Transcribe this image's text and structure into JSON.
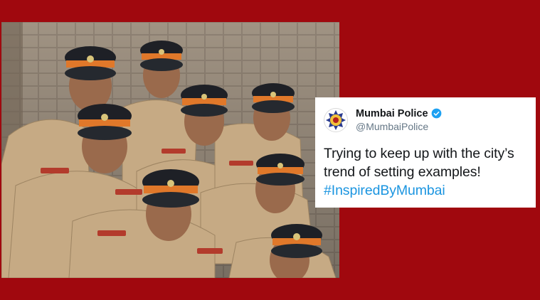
{
  "tweet": {
    "name": "Mumbai Police",
    "handle": "@MumbaiPolice",
    "text": "Trying to keep up with the city’s trend of setting examples!",
    "hashtag": "#InspiredByMumbai",
    "verified_icon": "verified-badge-icon",
    "hashtag_color": "#1b95e0"
  },
  "photo": {
    "subject": "group-of-policewomen-in-khaki-uniforms-and-peaked-caps"
  },
  "colors": {
    "background": "#a0080e",
    "uniform": "#c9ae8a",
    "cap": "#1e2026",
    "cap_band": "#e0782a"
  }
}
